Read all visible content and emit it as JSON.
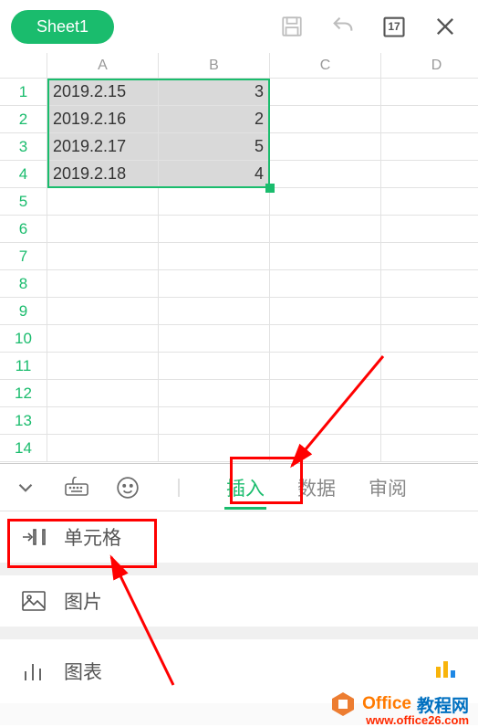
{
  "topbar": {
    "sheet_name": "Sheet1",
    "calendar_day": "17"
  },
  "grid": {
    "columns": [
      "A",
      "B",
      "C",
      "D"
    ],
    "rows": [
      {
        "n": "1",
        "a": "2019.2.15",
        "b": "3"
      },
      {
        "n": "2",
        "a": "2019.2.16",
        "b": "2"
      },
      {
        "n": "3",
        "a": "2019.2.17",
        "b": "5"
      },
      {
        "n": "4",
        "a": "2019.2.18",
        "b": "4"
      },
      {
        "n": "5",
        "a": "",
        "b": ""
      },
      {
        "n": "6",
        "a": "",
        "b": ""
      },
      {
        "n": "7",
        "a": "",
        "b": ""
      },
      {
        "n": "8",
        "a": "",
        "b": ""
      },
      {
        "n": "9",
        "a": "",
        "b": ""
      },
      {
        "n": "10",
        "a": "",
        "b": ""
      },
      {
        "n": "11",
        "a": "",
        "b": ""
      },
      {
        "n": "12",
        "a": "",
        "b": ""
      },
      {
        "n": "13",
        "a": "",
        "b": ""
      },
      {
        "n": "14",
        "a": "",
        "b": ""
      }
    ]
  },
  "bottombar": {
    "tabs": {
      "insert": "插入",
      "data": "数据",
      "review": "审阅"
    }
  },
  "panel": {
    "cell": "单元格",
    "image": "图片",
    "chart": "图表"
  },
  "watermark": {
    "brand1": "Office",
    "brand2": "教程网",
    "url": "www.office26.com"
  }
}
